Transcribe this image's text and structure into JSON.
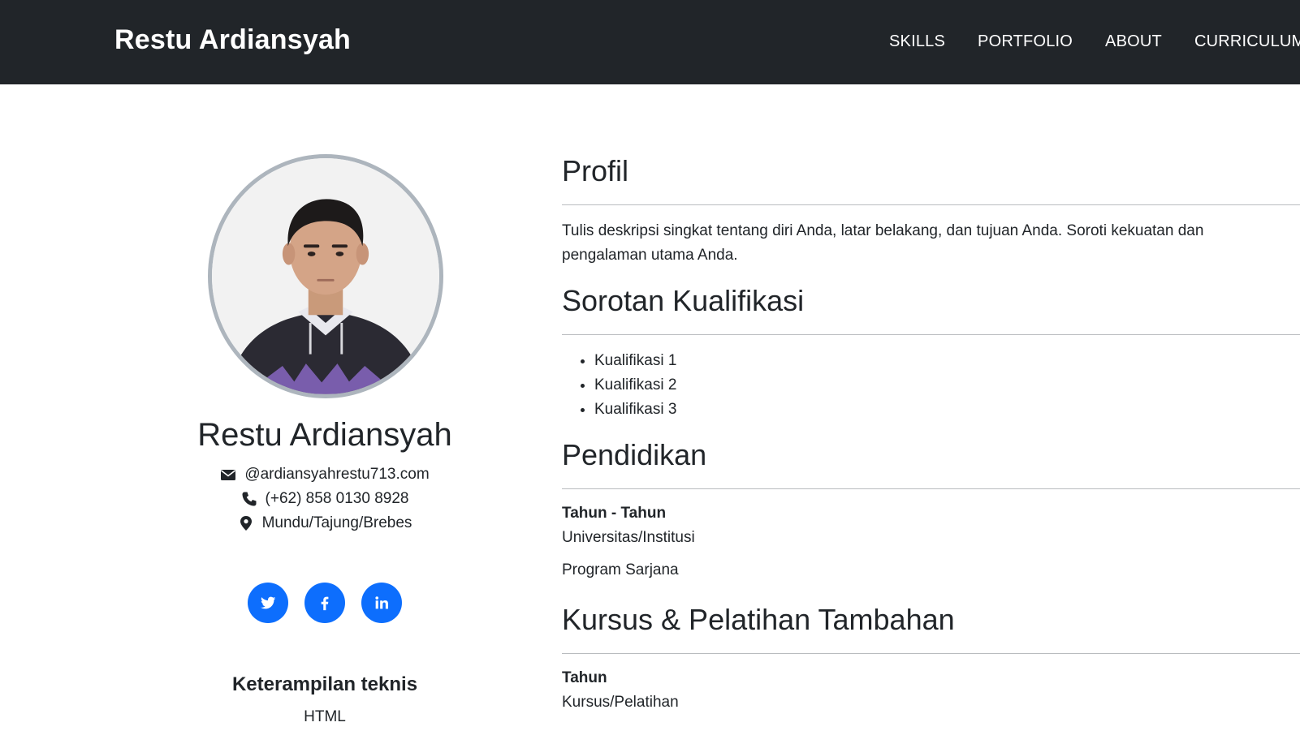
{
  "navbar": {
    "brand": "Restu Ardiansyah",
    "links": [
      "SKILLS",
      "PORTFOLIO",
      "ABOUT",
      "CURRICULUM VITAE"
    ]
  },
  "sidebar": {
    "name": "Restu Ardiansyah",
    "email": "@ardiansyahrestu713.com",
    "phone": "(+62) 858 0130 8928",
    "location": "Mundu/Tajung/Brebes",
    "socials": [
      "twitter-icon",
      "facebook-icon",
      "linkedin-icon"
    ],
    "skills_title": "Keterampilan teknis",
    "skills": [
      "HTML"
    ]
  },
  "main": {
    "profile": {
      "title": "Profil",
      "text": "Tulis deskripsi singkat tentang diri Anda, latar belakang, dan tujuan Anda. Soroti kekuatan dan pengalaman utama Anda."
    },
    "qualifications": {
      "title": "Sorotan Kualifikasi",
      "items": [
        "Kualifikasi 1",
        "Kualifikasi 2",
        "Kualifikasi 3"
      ]
    },
    "education": {
      "title": "Pendidikan",
      "years": "Tahun - Tahun",
      "institution": "Universitas/Institusi",
      "program": "Program Sarjana"
    },
    "courses": {
      "title": "Kursus & Pelatihan Tambahan",
      "year": "Tahun",
      "name": "Kursus/Pelatihan"
    }
  },
  "colors": {
    "navbar_bg": "#212529",
    "accent": "#0d6efd",
    "avatar_border": "#adb5bd"
  }
}
